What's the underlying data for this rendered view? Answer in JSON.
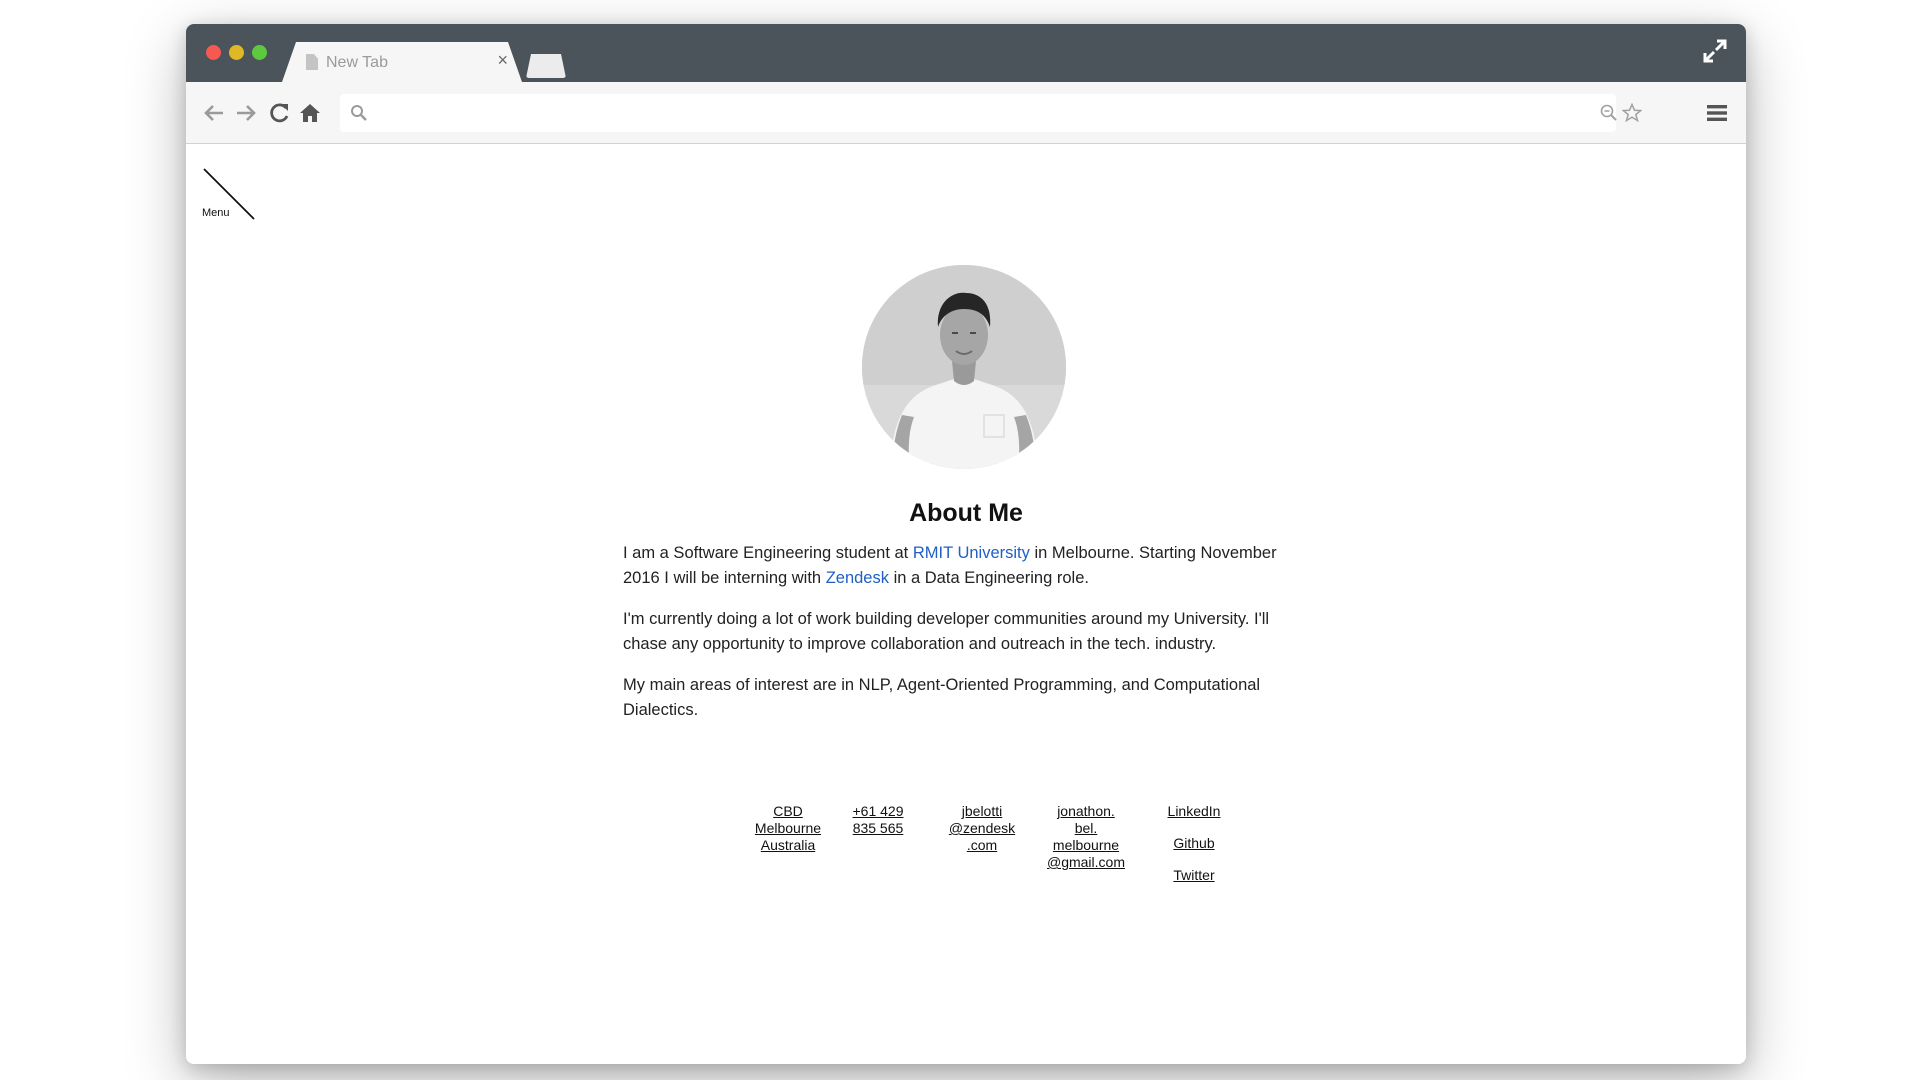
{
  "browser": {
    "tab_title": "New Tab",
    "tab_close": "×",
    "address_placeholder": "",
    "address_value": ""
  },
  "site": {
    "menu_label": "Menu",
    "heading": "About Me",
    "about": {
      "p1": {
        "before": "I am a Software Engineering student at ",
        "link1": "RMIT University",
        "middle": " in Melbourne. Starting November 2016 I will be interning with ",
        "link2": "Zendesk",
        "after": " in a Data Engineering role."
      },
      "p2": "I'm currently doing a lot of work building developer communities around my University. I'll chase any opportunity to improve collaboration and outreach in the tech. industry.",
      "p3": "My main areas of interest are in NLP, Agent-Oriented Programming, and Computational Dialectics."
    },
    "contacts": {
      "location": [
        "CBD",
        "Melbourne",
        "Australia"
      ],
      "phone": [
        "+61 429",
        "835 565"
      ],
      "work_email": [
        "jbelotti",
        "@zendesk",
        ".com"
      ],
      "personal_email": [
        "jonathon.",
        "bel.",
        "melbourne",
        "@gmail.com"
      ],
      "social": [
        "LinkedIn",
        "Github",
        "Twitter"
      ]
    }
  },
  "colors": {
    "titlebar": "#4a545a",
    "toolbar": "#f6f6f6",
    "link": "#1f5fc6",
    "close_dot": "#f45952",
    "minimize_dot": "#dfb826",
    "zoom_dot": "#5cc93f"
  },
  "icons": [
    "back-arrow-icon",
    "forward-arrow-icon",
    "reload-icon",
    "home-icon",
    "search-icon",
    "zoom-icon",
    "star-icon",
    "hamburger-menu-icon",
    "fullscreen-icon",
    "document-icon"
  ]
}
